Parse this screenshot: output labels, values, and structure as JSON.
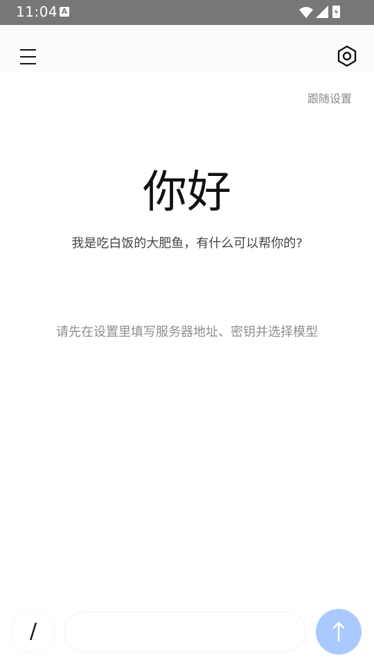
{
  "status_bar": {
    "time": "11:04",
    "notification_icon": "A"
  },
  "app_bar": {
    "menu_icon": "hamburger-menu-icon",
    "settings_icon": "hexagon-settings-icon"
  },
  "main": {
    "follow_settings": "跟随设置",
    "greeting": "你好",
    "intro": "我是吃白饭的大肥鱼，有什么可以帮你的?",
    "hint": "请先在设置里填写服务器地址、密钥并选择模型"
  },
  "composer": {
    "slash_label": "/",
    "input_value": "",
    "input_placeholder": "",
    "send_icon": "arrow-up-icon",
    "send_color": "#a9c9ff"
  }
}
